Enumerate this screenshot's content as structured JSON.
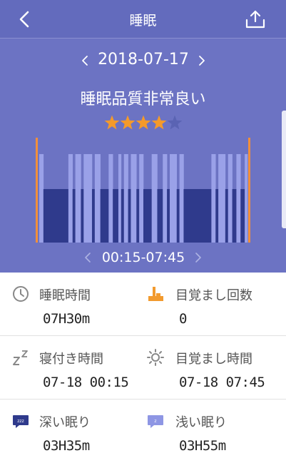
{
  "header": {
    "title": "睡眠",
    "back_icon": "chevron-left-icon",
    "share_icon": "share-upload-icon"
  },
  "date_nav": {
    "date": "2018-07-17"
  },
  "quality": {
    "text": "睡眠品質非常良い",
    "rating": 4,
    "rating_max": 5,
    "star_color": "#f49a2a",
    "star_empty_color": "#5a63b3"
  },
  "time_nav": {
    "range": "00:15-07:45"
  },
  "chart_data": {
    "type": "timeline",
    "colors": {
      "deep": "#2f3a8c",
      "light": "#9aa1e8",
      "marker": "#f28f3a",
      "background": "#6c73c3"
    },
    "segments": [
      {
        "stage": "light",
        "duration": 3
      },
      {
        "stage": "deep",
        "duration": 18
      },
      {
        "stage": "light",
        "duration": 3
      },
      {
        "stage": "deep",
        "duration": 2
      },
      {
        "stage": "light",
        "duration": 4
      },
      {
        "stage": "deep",
        "duration": 2
      },
      {
        "stage": "light",
        "duration": 6
      },
      {
        "stage": "deep",
        "duration": 2
      },
      {
        "stage": "light",
        "duration": 4
      },
      {
        "stage": "deep",
        "duration": 6
      },
      {
        "stage": "light",
        "duration": 3
      },
      {
        "stage": "deep",
        "duration": 4
      },
      {
        "stage": "light",
        "duration": 2
      },
      {
        "stage": "deep",
        "duration": 2
      },
      {
        "stage": "light",
        "duration": 3
      },
      {
        "stage": "deep",
        "duration": 2
      },
      {
        "stage": "light",
        "duration": 4
      },
      {
        "stage": "deep",
        "duration": 2
      },
      {
        "stage": "light",
        "duration": 3
      },
      {
        "stage": "deep",
        "duration": 6
      },
      {
        "stage": "light",
        "duration": 4
      },
      {
        "stage": "deep",
        "duration": 4
      },
      {
        "stage": "light",
        "duration": 3
      },
      {
        "stage": "deep",
        "duration": 2
      },
      {
        "stage": "light",
        "duration": 5
      },
      {
        "stage": "deep",
        "duration": 2
      },
      {
        "stage": "light",
        "duration": 3
      },
      {
        "stage": "deep",
        "duration": 20
      },
      {
        "stage": "light",
        "duration": 3
      },
      {
        "stage": "deep",
        "duration": 2
      },
      {
        "stage": "light",
        "duration": 5
      },
      {
        "stage": "deep",
        "duration": 2
      },
      {
        "stage": "light",
        "duration": 3
      },
      {
        "stage": "deep",
        "duration": 3
      },
      {
        "stage": "light",
        "duration": 3
      },
      {
        "stage": "deep",
        "duration": 3
      },
      {
        "stage": "light",
        "duration": 2
      }
    ]
  },
  "stats": {
    "sleep_time": {
      "label": "睡眠時間",
      "value": "07H30m",
      "icon": "clock-icon"
    },
    "wake_count": {
      "label": "目覚まし回数",
      "value": "0",
      "icon": "wake-up-icon"
    },
    "bed_time": {
      "label": "寝付き時間",
      "value": "07-18 00:15",
      "icon": "zz-icon"
    },
    "wake_time": {
      "label": "目覚まし時間",
      "value": "07-18 07:45",
      "icon": "sun-icon"
    },
    "deep_sleep": {
      "label": "深い眠り",
      "value": "03H35m",
      "icon": "deep-sleep-icon"
    },
    "light_sleep": {
      "label": "浅い眠り",
      "value": "03H55m",
      "icon": "light-sleep-icon"
    }
  }
}
